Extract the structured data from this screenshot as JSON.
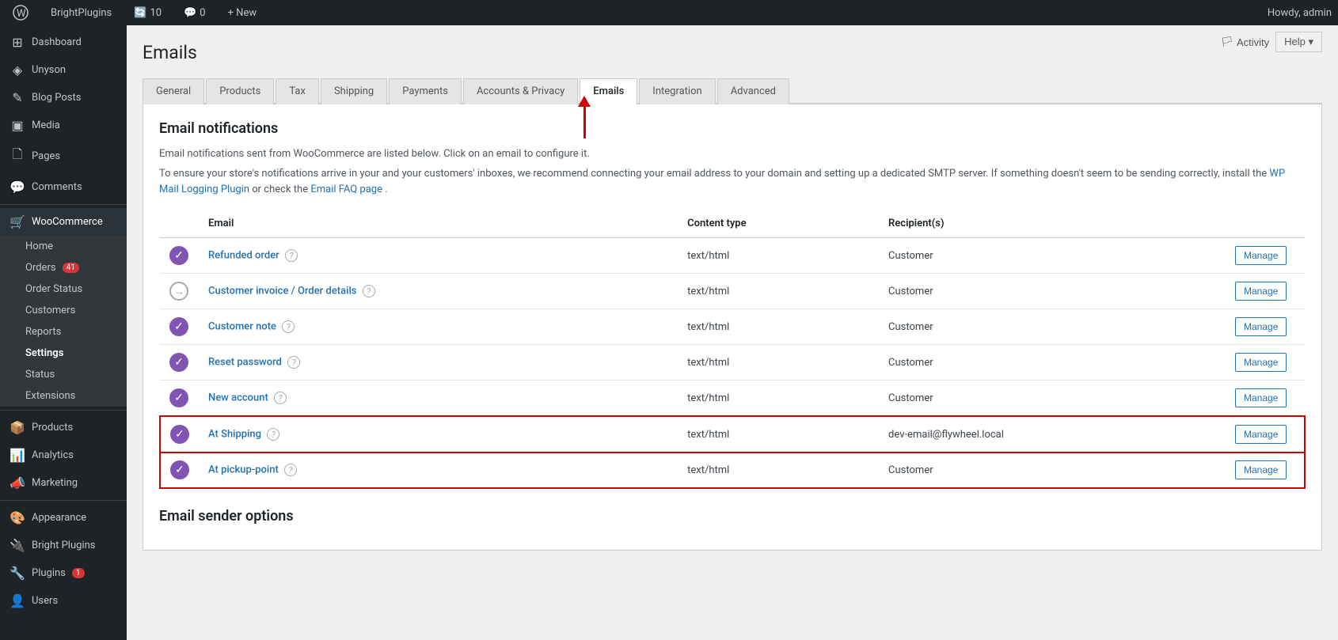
{
  "adminbar": {
    "site_name": "BrightPlugins",
    "updates_count": "10",
    "comments_count": "0",
    "new_label": "+ New",
    "howdy": "Howdy, admin"
  },
  "sidebar": {
    "items": [
      {
        "id": "dashboard",
        "label": "Dashboard",
        "icon": "⊞"
      },
      {
        "id": "unyson",
        "label": "Unyson",
        "icon": "◈"
      },
      {
        "id": "blog-posts",
        "label": "Blog Posts",
        "icon": "✎"
      },
      {
        "id": "media",
        "label": "Media",
        "icon": "▣"
      },
      {
        "id": "pages",
        "label": "Pages",
        "icon": "⬜"
      },
      {
        "id": "comments",
        "label": "Comments",
        "icon": "💬"
      },
      {
        "id": "woocommerce",
        "label": "WooCommerce",
        "icon": "🛒",
        "active": true
      }
    ],
    "woo_sub": [
      {
        "id": "home",
        "label": "Home"
      },
      {
        "id": "orders",
        "label": "Orders",
        "badge": "41"
      },
      {
        "id": "order-status",
        "label": "Order Status"
      },
      {
        "id": "customers",
        "label": "Customers"
      },
      {
        "id": "reports",
        "label": "Reports"
      },
      {
        "id": "settings",
        "label": "Settings",
        "active": true
      },
      {
        "id": "status",
        "label": "Status"
      },
      {
        "id": "extensions",
        "label": "Extensions"
      }
    ],
    "bottom_items": [
      {
        "id": "products",
        "label": "Products",
        "icon": "📦"
      },
      {
        "id": "analytics",
        "label": "Analytics",
        "icon": "📊"
      },
      {
        "id": "marketing",
        "label": "Marketing",
        "icon": "📣"
      },
      {
        "id": "appearance",
        "label": "Appearance",
        "icon": "🎨"
      },
      {
        "id": "bright-plugins",
        "label": "Bright Plugins",
        "icon": "🔌"
      },
      {
        "id": "plugins",
        "label": "Plugins",
        "icon": "🔧",
        "badge": "1"
      },
      {
        "id": "users",
        "label": "Users",
        "icon": "👤"
      }
    ]
  },
  "page": {
    "title": "Emails",
    "activity_label": "Activity",
    "help_label": "Help ▾"
  },
  "tabs": [
    {
      "id": "general",
      "label": "General"
    },
    {
      "id": "products",
      "label": "Products"
    },
    {
      "id": "tax",
      "label": "Tax"
    },
    {
      "id": "shipping",
      "label": "Shipping"
    },
    {
      "id": "payments",
      "label": "Payments"
    },
    {
      "id": "accounts-privacy",
      "label": "Accounts & Privacy"
    },
    {
      "id": "emails",
      "label": "Emails",
      "active": true
    },
    {
      "id": "integration",
      "label": "Integration"
    },
    {
      "id": "advanced",
      "label": "Advanced"
    }
  ],
  "email_section": {
    "title": "Email notifications",
    "desc1": "Email notifications sent from WooCommerce are listed below. Click on an email to configure it.",
    "desc2": "To ensure your store's notifications arrive in your and your customers' inboxes, we recommend connecting your email address to your domain and setting up a dedicated SMTP server. If something doesn't seem to be sending correctly, install the",
    "link1_text": "WP Mail Logging Plugin",
    "desc3": "or check the",
    "link2_text": "Email FAQ page",
    "desc4": ".",
    "table": {
      "headers": [
        "",
        "Email",
        "Content type",
        "Recipient(s)",
        ""
      ],
      "rows": [
        {
          "id": "refunded-order",
          "status": "enabled",
          "name": "Refunded order",
          "content_type": "text/html",
          "recipient": "Customer",
          "manage_label": "Manage",
          "highlighted": false
        },
        {
          "id": "customer-invoice",
          "status": "disabled",
          "name": "Customer invoice / Order details",
          "content_type": "text/html",
          "recipient": "Customer",
          "manage_label": "Manage",
          "highlighted": false
        },
        {
          "id": "customer-note",
          "status": "enabled",
          "name": "Customer note",
          "content_type": "text/html",
          "recipient": "Customer",
          "manage_label": "Manage",
          "highlighted": false
        },
        {
          "id": "reset-password",
          "status": "enabled",
          "name": "Reset password",
          "content_type": "text/html",
          "recipient": "Customer",
          "manage_label": "Manage",
          "highlighted": false
        },
        {
          "id": "new-account",
          "status": "enabled",
          "name": "New account",
          "content_type": "text/html",
          "recipient": "Customer",
          "manage_label": "Manage",
          "highlighted": false
        },
        {
          "id": "at-shipping",
          "status": "enabled",
          "name": "At Shipping",
          "content_type": "text/html",
          "recipient": "dev-email@flywheel.local",
          "manage_label": "Manage",
          "highlighted": true
        },
        {
          "id": "at-pickup-point",
          "status": "enabled",
          "name": "At pickup-point",
          "content_type": "text/html",
          "recipient": "Customer",
          "manage_label": "Manage",
          "highlighted": true
        }
      ]
    }
  },
  "email_sender_section": {
    "title": "Email sender options"
  }
}
